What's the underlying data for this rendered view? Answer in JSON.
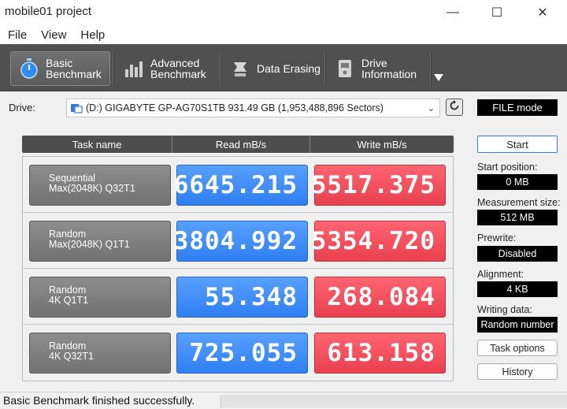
{
  "window": {
    "title": "mobile01 project",
    "minimize_glyph": "—",
    "maximize_glyph": "☐",
    "close_glyph": "✕"
  },
  "menu": [
    "File",
    "View",
    "Help"
  ],
  "toolbar": {
    "tabs": [
      {
        "line1": "Basic",
        "line2": "Benchmark",
        "icon": "stopwatch-icon",
        "active": true
      },
      {
        "line1": "Advanced",
        "line2": "Benchmark",
        "icon": "bar-chart-icon",
        "active": false
      },
      {
        "line1": "Data Erasing",
        "line2": "",
        "icon": "eraser-icon",
        "active": false
      },
      {
        "line1": "Drive",
        "line2": "Information",
        "icon": "drive-info-icon",
        "active": false
      }
    ],
    "more_icon": "dropdown-arrow-icon"
  },
  "drive": {
    "label": "Drive:",
    "selected": "(D:) GIGABYTE GP-AG70S1TB  931.49 GB (1,953,488,896 Sectors)",
    "caret": "⌄"
  },
  "file_mode_label": "FILE mode",
  "grid": {
    "headers": [
      "Task name",
      "Read mB/s",
      "Write mB/s"
    ],
    "rows": [
      {
        "task_line1": "Sequential",
        "task_line2": "Max(2048K) Q32T1",
        "read": "6645.215",
        "write": "5517.375"
      },
      {
        "task_line1": "Random",
        "task_line2": "Max(2048K) Q1T1",
        "read": "3804.992",
        "write": "5354.720"
      },
      {
        "task_line1": "Random",
        "task_line2": "4K Q1T1",
        "read": "55.348",
        "write": "268.084"
      },
      {
        "task_line1": "Random",
        "task_line2": "4K Q32T1",
        "read": "725.055",
        "write": "613.158"
      }
    ]
  },
  "panel": {
    "start_label": "Start",
    "start_position_label": "Start position:",
    "start_position_value": "0 MB",
    "measurement_size_label": "Measurement size:",
    "measurement_size_value": "512 MB",
    "prewrite_label": "Prewrite:",
    "prewrite_value": "Disabled",
    "alignment_label": "Alignment:",
    "alignment_value": "4 KB",
    "writing_data_label": "Writing data:",
    "writing_data_value": "Random number",
    "task_options_label": "Task options",
    "history_label": "History"
  },
  "status": {
    "text": "Basic Benchmark finished successfully."
  },
  "colors": {
    "read": "#3b8cff",
    "write": "#f04f5c",
    "toolbar": "#505050"
  }
}
